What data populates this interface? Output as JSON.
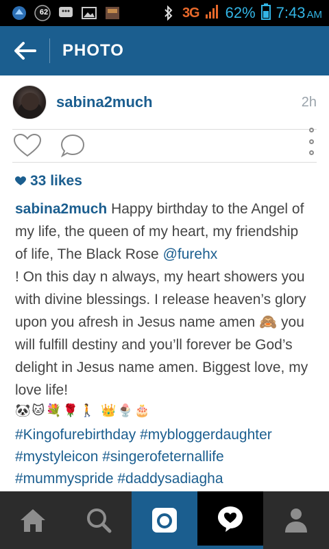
{
  "status_bar": {
    "notification_count": "62",
    "network": "3G",
    "battery_percent": "62%",
    "time": "7:43",
    "ampm": "AM"
  },
  "header": {
    "title": "PHOTO"
  },
  "post": {
    "username": "sabina2much",
    "time_ago": "2h",
    "likes": "33 likes",
    "caption_user": "sabina2much",
    "caption_part1": "Happy birthday to the Angel of my life, the queen of my heart, my friendship of life, The Black Rose",
    "mention": "@furehx",
    "caption_part2": "! On this day n always, my heart showers you with divine blessings. I release heaven’s glory upon you afresh in Jesus name amen 🙈 you will fulfill destiny and you’ll forever be God’s delight in Jesus name amen. Biggest love, my love life!",
    "emoji_line": "🐼🐱💐🌹🚶 👑🍨🎂",
    "hashtags": "#Kingofurebirthday #mybloggerdaughter #mystyleicon #singerofeternallife #mummyspride #daddysadiagha"
  },
  "icons": {
    "back": "arrow-left-icon",
    "like": "heart-outline-icon",
    "comment": "speech-bubble-icon",
    "more": "vertical-dots-icon",
    "home": "home-icon",
    "search": "search-icon",
    "camera": "camera-icon",
    "activity": "heart-bubble-icon",
    "profile": "person-icon"
  },
  "colors": {
    "brand_blue": "#1b5e8f",
    "status_blue": "#33b5e5",
    "network_orange": "#e8692b"
  }
}
